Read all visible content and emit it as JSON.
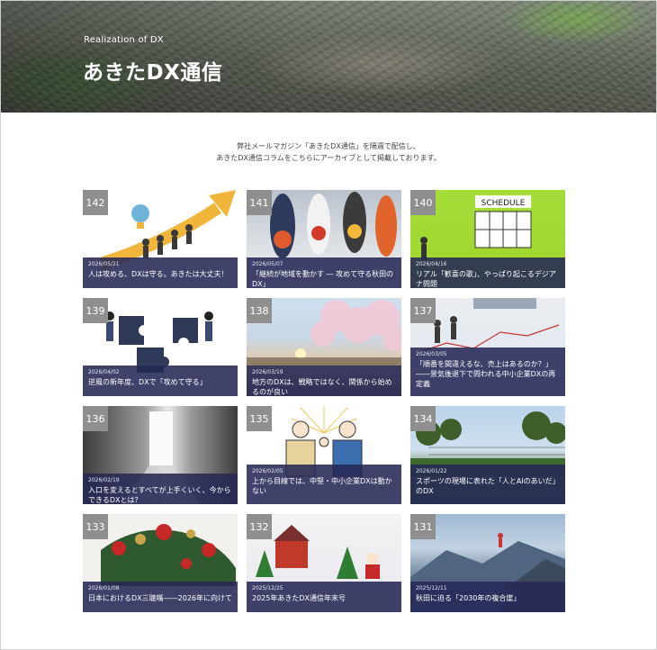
{
  "hero": {
    "subtitle": "Realization of DX",
    "title": "あきたDX通信"
  },
  "intro": {
    "line1": "弊社メールマガジン「あきたDX通信」を隔週で配信し、",
    "line2": "あきたDX通信コラムをこちらにアーカイブとして掲載しております。"
  },
  "articles": [
    {
      "number": "142",
      "date": "2026/05/21",
      "title": "人は攻める、DXは守る。あきたは大丈夫！"
    },
    {
      "number": "141",
      "date": "2026/05/07",
      "title": "「継続が地域を動かす ― 攻めて守る秋田のDX」"
    },
    {
      "number": "140",
      "date": "2026/04/16",
      "title": "リアル「歓喜の歌」、やっぱり起こるデジアナ問題"
    },
    {
      "number": "139",
      "date": "2026/04/02",
      "title": "逆風の新年度、DXで「攻めて守る」"
    },
    {
      "number": "138",
      "date": "2026/03/19",
      "title": "地方のDXは、戦略ではなく、関係から始めるのが良い"
    },
    {
      "number": "137",
      "date": "2026/03/05",
      "title": "「順番を間違えるな、売上はあるのか？」――景気後退下で問われる中小企業DXの再定義"
    },
    {
      "number": "136",
      "date": "2026/02/19",
      "title": "入口を変えるとすべてが上手くいく、今からできるDXとは？"
    },
    {
      "number": "135",
      "date": "2026/02/05",
      "title": "上から目線では、中堅・中小企業DXは動かない"
    },
    {
      "number": "134",
      "date": "2026/01/22",
      "title": "スポーツの現場に表れた「人とAIのあいだ」のDX"
    },
    {
      "number": "133",
      "date": "2026/01/08",
      "title": "日本におけるDX三聴嘴――2026年に向けて"
    },
    {
      "number": "132",
      "date": "2025/12/25",
      "title": "2025年あきたDX通信年末号"
    },
    {
      "number": "131",
      "date": "2025/12/11",
      "title": "秋田に迫る「2030年の複合崖」"
    }
  ],
  "illustrations": {
    "schedule_sign": "SCHEDULE"
  }
}
